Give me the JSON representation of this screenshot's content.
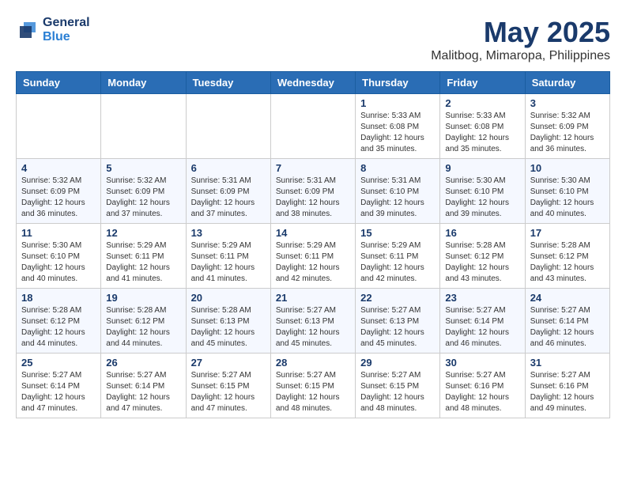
{
  "header": {
    "logo_general": "General",
    "logo_blue": "Blue",
    "month": "May 2025",
    "location": "Malitbog, Mimaropa, Philippines"
  },
  "weekdays": [
    "Sunday",
    "Monday",
    "Tuesday",
    "Wednesday",
    "Thursday",
    "Friday",
    "Saturday"
  ],
  "weeks": [
    [
      {
        "day": "",
        "info": ""
      },
      {
        "day": "",
        "info": ""
      },
      {
        "day": "",
        "info": ""
      },
      {
        "day": "",
        "info": ""
      },
      {
        "day": "1",
        "info": "Sunrise: 5:33 AM\nSunset: 6:08 PM\nDaylight: 12 hours\nand 35 minutes."
      },
      {
        "day": "2",
        "info": "Sunrise: 5:33 AM\nSunset: 6:08 PM\nDaylight: 12 hours\nand 35 minutes."
      },
      {
        "day": "3",
        "info": "Sunrise: 5:32 AM\nSunset: 6:09 PM\nDaylight: 12 hours\nand 36 minutes."
      }
    ],
    [
      {
        "day": "4",
        "info": "Sunrise: 5:32 AM\nSunset: 6:09 PM\nDaylight: 12 hours\nand 36 minutes."
      },
      {
        "day": "5",
        "info": "Sunrise: 5:32 AM\nSunset: 6:09 PM\nDaylight: 12 hours\nand 37 minutes."
      },
      {
        "day": "6",
        "info": "Sunrise: 5:31 AM\nSunset: 6:09 PM\nDaylight: 12 hours\nand 37 minutes."
      },
      {
        "day": "7",
        "info": "Sunrise: 5:31 AM\nSunset: 6:09 PM\nDaylight: 12 hours\nand 38 minutes."
      },
      {
        "day": "8",
        "info": "Sunrise: 5:31 AM\nSunset: 6:10 PM\nDaylight: 12 hours\nand 39 minutes."
      },
      {
        "day": "9",
        "info": "Sunrise: 5:30 AM\nSunset: 6:10 PM\nDaylight: 12 hours\nand 39 minutes."
      },
      {
        "day": "10",
        "info": "Sunrise: 5:30 AM\nSunset: 6:10 PM\nDaylight: 12 hours\nand 40 minutes."
      }
    ],
    [
      {
        "day": "11",
        "info": "Sunrise: 5:30 AM\nSunset: 6:10 PM\nDaylight: 12 hours\nand 40 minutes."
      },
      {
        "day": "12",
        "info": "Sunrise: 5:29 AM\nSunset: 6:11 PM\nDaylight: 12 hours\nand 41 minutes."
      },
      {
        "day": "13",
        "info": "Sunrise: 5:29 AM\nSunset: 6:11 PM\nDaylight: 12 hours\nand 41 minutes."
      },
      {
        "day": "14",
        "info": "Sunrise: 5:29 AM\nSunset: 6:11 PM\nDaylight: 12 hours\nand 42 minutes."
      },
      {
        "day": "15",
        "info": "Sunrise: 5:29 AM\nSunset: 6:11 PM\nDaylight: 12 hours\nand 42 minutes."
      },
      {
        "day": "16",
        "info": "Sunrise: 5:28 AM\nSunset: 6:12 PM\nDaylight: 12 hours\nand 43 minutes."
      },
      {
        "day": "17",
        "info": "Sunrise: 5:28 AM\nSunset: 6:12 PM\nDaylight: 12 hours\nand 43 minutes."
      }
    ],
    [
      {
        "day": "18",
        "info": "Sunrise: 5:28 AM\nSunset: 6:12 PM\nDaylight: 12 hours\nand 44 minutes."
      },
      {
        "day": "19",
        "info": "Sunrise: 5:28 AM\nSunset: 6:12 PM\nDaylight: 12 hours\nand 44 minutes."
      },
      {
        "day": "20",
        "info": "Sunrise: 5:28 AM\nSunset: 6:13 PM\nDaylight: 12 hours\nand 45 minutes."
      },
      {
        "day": "21",
        "info": "Sunrise: 5:27 AM\nSunset: 6:13 PM\nDaylight: 12 hours\nand 45 minutes."
      },
      {
        "day": "22",
        "info": "Sunrise: 5:27 AM\nSunset: 6:13 PM\nDaylight: 12 hours\nand 45 minutes."
      },
      {
        "day": "23",
        "info": "Sunrise: 5:27 AM\nSunset: 6:14 PM\nDaylight: 12 hours\nand 46 minutes."
      },
      {
        "day": "24",
        "info": "Sunrise: 5:27 AM\nSunset: 6:14 PM\nDaylight: 12 hours\nand 46 minutes."
      }
    ],
    [
      {
        "day": "25",
        "info": "Sunrise: 5:27 AM\nSunset: 6:14 PM\nDaylight: 12 hours\nand 47 minutes."
      },
      {
        "day": "26",
        "info": "Sunrise: 5:27 AM\nSunset: 6:14 PM\nDaylight: 12 hours\nand 47 minutes."
      },
      {
        "day": "27",
        "info": "Sunrise: 5:27 AM\nSunset: 6:15 PM\nDaylight: 12 hours\nand 47 minutes."
      },
      {
        "day": "28",
        "info": "Sunrise: 5:27 AM\nSunset: 6:15 PM\nDaylight: 12 hours\nand 48 minutes."
      },
      {
        "day": "29",
        "info": "Sunrise: 5:27 AM\nSunset: 6:15 PM\nDaylight: 12 hours\nand 48 minutes."
      },
      {
        "day": "30",
        "info": "Sunrise: 5:27 AM\nSunset: 6:16 PM\nDaylight: 12 hours\nand 48 minutes."
      },
      {
        "day": "31",
        "info": "Sunrise: 5:27 AM\nSunset: 6:16 PM\nDaylight: 12 hours\nand 49 minutes."
      }
    ]
  ]
}
